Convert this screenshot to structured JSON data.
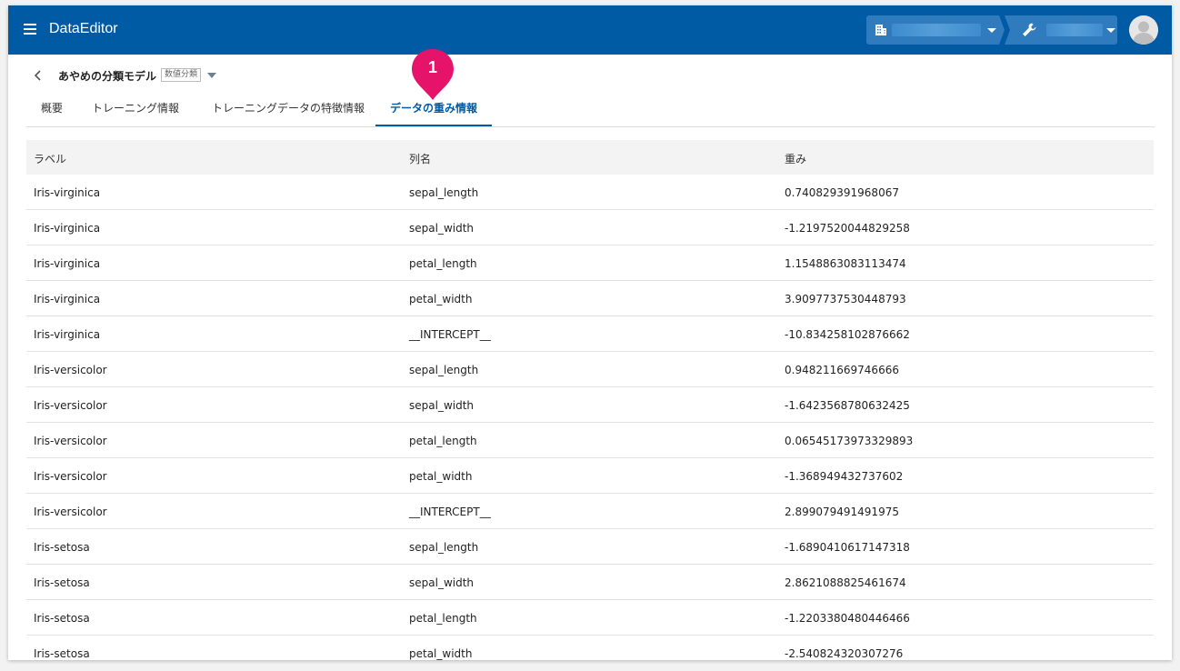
{
  "header": {
    "app_title": "DataEditor",
    "menu_icon": "hamburger-menu-icon",
    "org_icon": "building-icon",
    "tool_icon": "wrench-icon",
    "avatar_icon": "user-avatar-icon",
    "brand_color": "#005ba4"
  },
  "breadcrumb": {
    "model_name": "あやめの分類モデル",
    "model_type_badge": "数値分類"
  },
  "tabs": [
    {
      "label": "概要"
    },
    {
      "label": "トレーニング情報"
    },
    {
      "label": "トレーニングデータの特徴情報"
    },
    {
      "label": "データの重み情報",
      "active": true
    }
  ],
  "step_marker": {
    "label": "1",
    "color": "#e5146a"
  },
  "table": {
    "headers": [
      "ラベル",
      "列名",
      "重み"
    ],
    "rows": [
      [
        "Iris-virginica",
        "sepal_length",
        "0.740829391968067"
      ],
      [
        "Iris-virginica",
        "sepal_width",
        "-1.2197520044829258"
      ],
      [
        "Iris-virginica",
        "petal_length",
        "1.1548863083113474"
      ],
      [
        "Iris-virginica",
        "petal_width",
        "3.9097737530448793"
      ],
      [
        "Iris-virginica",
        "__INTERCEPT__",
        "-10.834258102876662"
      ],
      [
        "Iris-versicolor",
        "sepal_length",
        "0.948211669746666"
      ],
      [
        "Iris-versicolor",
        "sepal_width",
        "-1.6423568780632425"
      ],
      [
        "Iris-versicolor",
        "petal_length",
        "0.06545173973329893"
      ],
      [
        "Iris-versicolor",
        "petal_width",
        "-1.368949432737602"
      ],
      [
        "Iris-versicolor",
        "__INTERCEPT__",
        "2.899079491491975"
      ],
      [
        "Iris-setosa",
        "sepal_length",
        "-1.6890410617147318"
      ],
      [
        "Iris-setosa",
        "sepal_width",
        "2.8621088825461674"
      ],
      [
        "Iris-setosa",
        "petal_length",
        "-1.2203380480446466"
      ],
      [
        "Iris-setosa",
        "petal_width",
        "-2.540824320307276"
      ]
    ]
  }
}
